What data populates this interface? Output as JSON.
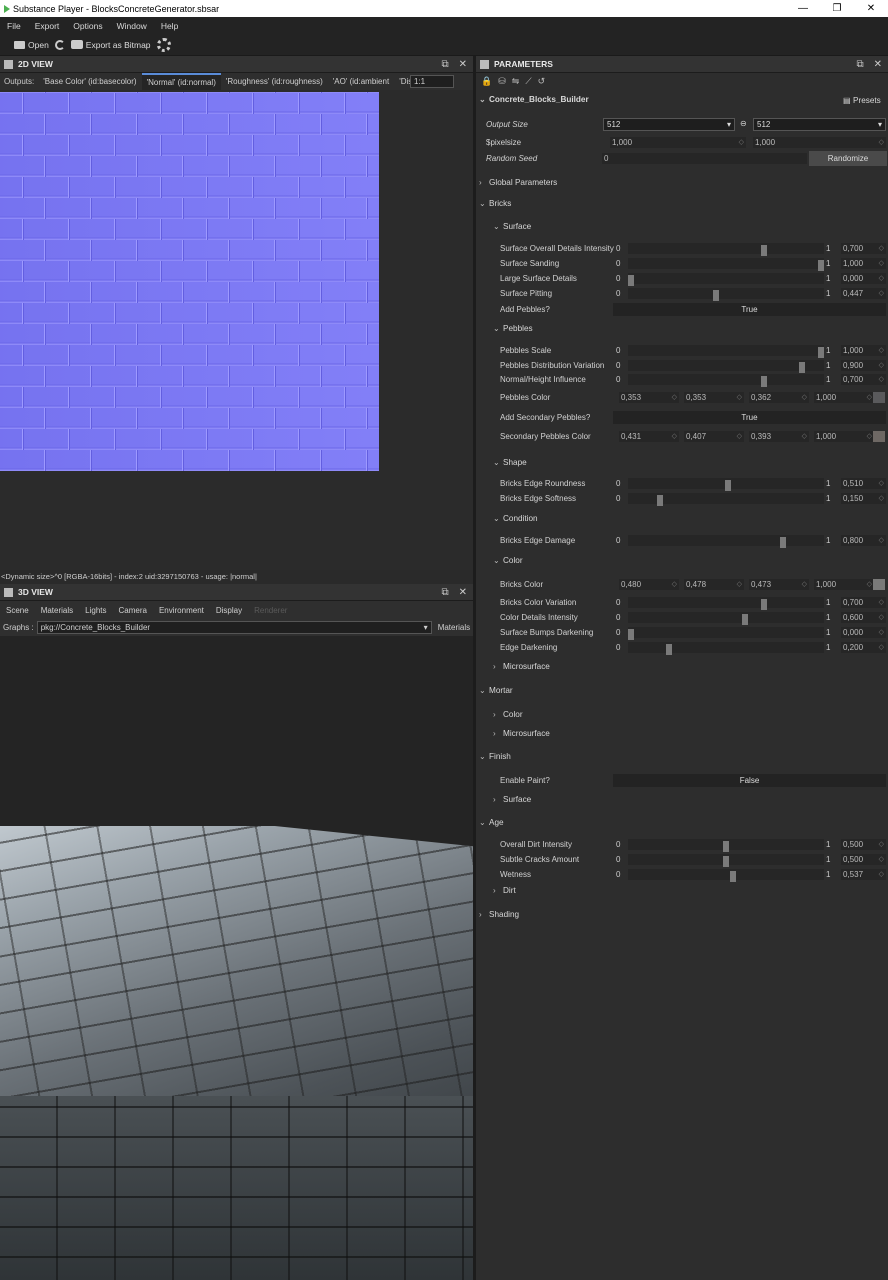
{
  "window": {
    "title": "Substance Player - BlocksConcreteGenerator.sbsar",
    "minimize": "—",
    "restore": "❐",
    "close": "✕"
  },
  "menu": [
    "File",
    "Export",
    "Options",
    "Window",
    "Help"
  ],
  "toolbar": {
    "open": "Open",
    "export_bitmap": "Export as Bitmap"
  },
  "view2d": {
    "title": "2D VIEW",
    "outputs_label": "Outputs:",
    "tabs": [
      "'Base Color' (id:basecolor)",
      "'Normal' (id:normal)",
      "'Roughness' (id:roughness)",
      "'AO' (id:ambient",
      "'Dis"
    ],
    "active_tab": 1,
    "zoom": "1:1",
    "status": "<Dynamic size>^0 [RGBA-16bits] - index:2 uid:3297150763 - usage: |normal|"
  },
  "view3d": {
    "title": "3D VIEW",
    "menu": [
      "Scene",
      "Materials",
      "Lights",
      "Camera",
      "Environment",
      "Display",
      "Renderer"
    ],
    "graphs_label": "Graphs :",
    "graph_value": "pkg://Concrete_Blocks_Builder",
    "materials": "Materials"
  },
  "params": {
    "title": "PARAMETERS",
    "graph_name": "Concrete_Blocks_Builder",
    "presets": "Presets",
    "output_size_label": "Output Size",
    "output_size_w": "512",
    "output_size_h": "512",
    "pixelsize_label": "$pixelsize",
    "pixelsize_w": "1,000",
    "pixelsize_h": "1,000",
    "random_seed_label": "Random Seed",
    "random_seed": "0",
    "randomize": "Randomize",
    "sections": {
      "global": "Global Parameters",
      "bricks": "Bricks",
      "surface": "Surface",
      "pebbles": "Pebbles",
      "shape": "Shape",
      "condition": "Condition",
      "color": "Color",
      "microsurface": "Microsurface",
      "mortar": "Mortar",
      "mortar_color": "Color",
      "mortar_microsurface": "Microsurface",
      "finish": "Finish",
      "finish_surface": "Surface",
      "age": "Age",
      "dirt": "Dirt",
      "shading": "Shading"
    },
    "sliders": [
      {
        "label": "Surface Overall Details Intensity",
        "min": "0",
        "max": "1",
        "value": "0,700",
        "v": 0.7
      },
      {
        "label": "Surface Sanding",
        "min": "0",
        "max": "1",
        "value": "1,000",
        "v": 1.0
      },
      {
        "label": "Large Surface Details",
        "min": "0",
        "max": "1",
        "value": "0,000",
        "v": 0.0
      },
      {
        "label": "Surface Pitting",
        "min": "0",
        "max": "1",
        "value": "0,447",
        "v": 0.447
      },
      {
        "label": "Pebbles Scale",
        "min": "0",
        "max": "1",
        "value": "1,000",
        "v": 1.0
      },
      {
        "label": "Pebbles Distribution Variation",
        "min": "0",
        "max": "1",
        "value": "0,900",
        "v": 0.9
      },
      {
        "label": "Normal/Height Influence",
        "min": "0",
        "max": "1",
        "value": "0,700",
        "v": 0.7
      },
      {
        "label": "Bricks Edge Roundness",
        "min": "0",
        "max": "1",
        "value": "0,510",
        "v": 0.51
      },
      {
        "label": "Bricks Edge Softness",
        "min": "0",
        "max": "1",
        "value": "0,150",
        "v": 0.15
      },
      {
        "label": "Bricks Edge Damage",
        "min": "0",
        "max": "1",
        "value": "0,800",
        "v": 0.8
      },
      {
        "label": "Bricks Color Variation",
        "min": "0",
        "max": "1",
        "value": "0,700",
        "v": 0.7
      },
      {
        "label": "Color Details Intensity",
        "min": "0",
        "max": "1",
        "value": "0,600",
        "v": 0.6
      },
      {
        "label": "Surface Bumps Darkening",
        "min": "0",
        "max": "1",
        "value": "0,000",
        "v": 0.0
      },
      {
        "label": "Edge Darkening",
        "min": "0",
        "max": "1",
        "value": "0,200",
        "v": 0.2
      },
      {
        "label": "Overall Dirt Intensity",
        "min": "0",
        "max": "1",
        "value": "0,500",
        "v": 0.5
      },
      {
        "label": "Subtle Cracks Amount",
        "min": "0",
        "max": "1",
        "value": "0,500",
        "v": 0.5
      },
      {
        "label": "Wetness",
        "min": "0",
        "max": "1",
        "value": "0,537",
        "v": 0.537
      }
    ],
    "bools": [
      {
        "label": "Add Pebbles?",
        "value": "True"
      },
      {
        "label": "Add Secondary Pebbles?",
        "value": "True"
      },
      {
        "label": "Enable Paint?",
        "value": "False"
      }
    ],
    "colors": [
      {
        "label": "Pebbles Color",
        "r": "0,353",
        "g": "0,353",
        "b": "0,362",
        "a": "1,000",
        "swatch": "#5a5a5c"
      },
      {
        "label": "Secondary Pebbles Color",
        "r": "0,431",
        "g": "0,407",
        "b": "0,393",
        "a": "1,000",
        "swatch": "#6e6864"
      },
      {
        "label": "Bricks Color",
        "r": "0,480",
        "g": "0,478",
        "b": "0,473",
        "a": "1,000",
        "swatch": "#7a7a79"
      }
    ]
  }
}
